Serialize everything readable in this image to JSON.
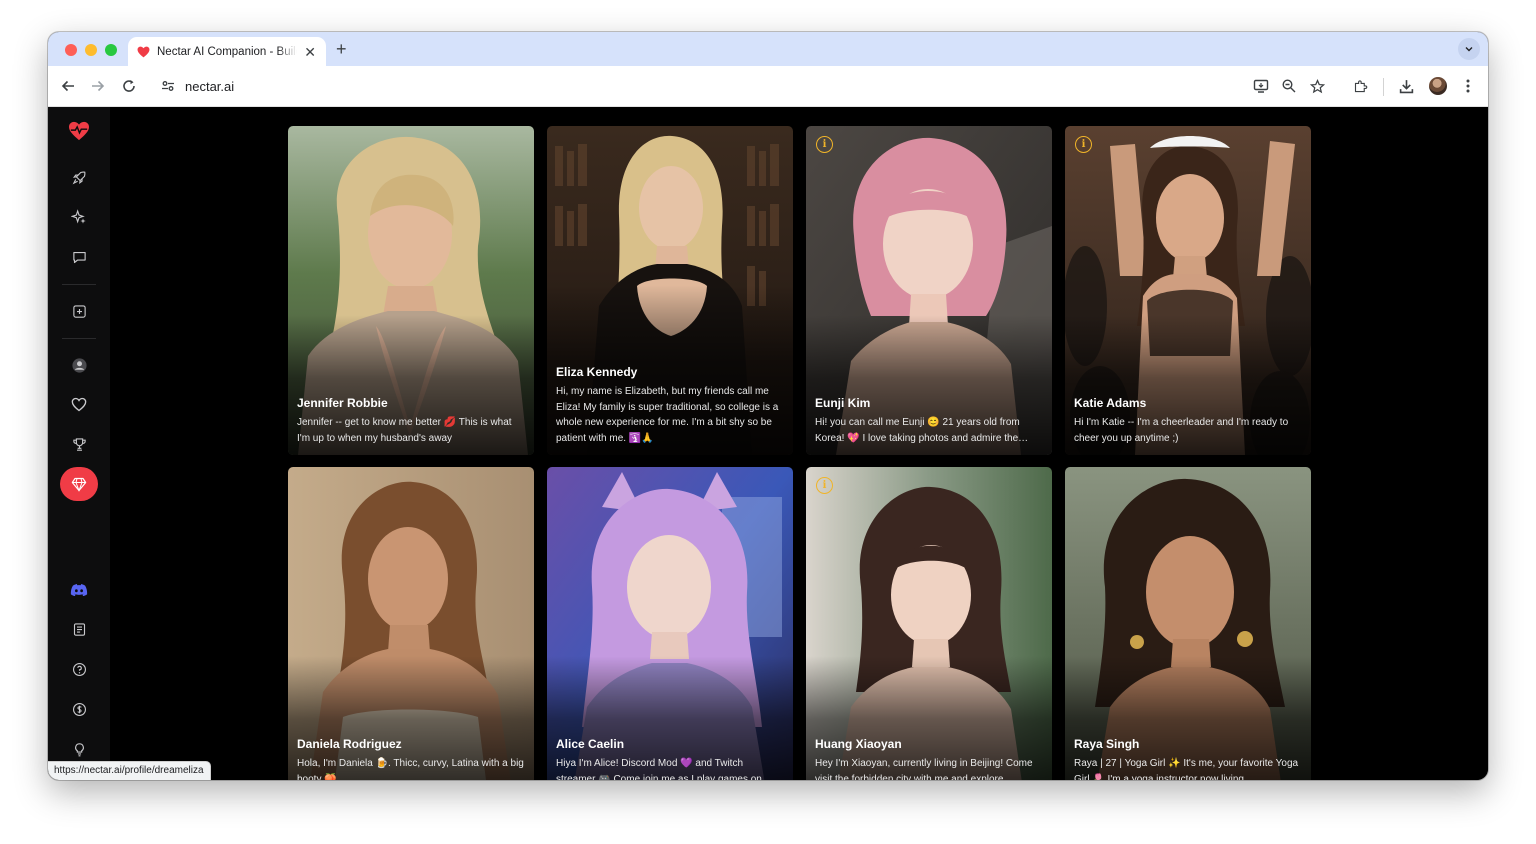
{
  "browser": {
    "tab_title": "Nectar AI Companion - Build Your AI",
    "url": "nectar.ai",
    "status_url": "https://nectar.ai/profile/dreameliza"
  },
  "sidebar": {
    "items": [
      "logo-heart",
      "rocket",
      "sparkles",
      "chat",
      "create",
      "profile",
      "favorites",
      "trophy",
      "premium",
      "discord",
      "blog",
      "help",
      "pricing",
      "ideas"
    ]
  },
  "colors": {
    "accent": "#f03c46",
    "info": "#f0b429",
    "discord": "#5865f2"
  },
  "characters": [
    {
      "name": "Jennifer Robbie",
      "description": "Jennifer -- get to know me better 💋 This is what I'm up to when my husband's away",
      "info_badge": false
    },
    {
      "name": "Eliza Kennedy",
      "description": "Hi, my name is Elizabeth, but my friends call me Eliza! My family is super traditional, so college is a whole new experience for me. I'm a bit shy so be patient with me. 🛐🙏",
      "info_badge": false
    },
    {
      "name": "Eunji Kim",
      "description": "Hi! you can call me Eunji 😊 21 years old from Korea! 💖 I love taking photos and admire the beauty of everyday life",
      "info_badge": true
    },
    {
      "name": "Katie Adams",
      "description": "Hi I'm Katie -- I'm a cheerleader and I'm ready to cheer you up anytime ;)",
      "info_badge": true
    },
    {
      "name": "Daniela Rodriguez",
      "description": "Hola, I'm Daniela 🍺. Thicc, curvy, Latina with a big booty 🍑",
      "info_badge": false
    },
    {
      "name": "Alice Caelin",
      "description": "Hiya I'm Alice! Discord Mod 💜 and Twitch streamer 🎮 Come join me as I play games on stream",
      "info_badge": false
    },
    {
      "name": "Huang Xiaoyan",
      "description": "Hey I'm Xiaoyan, currently living in Beijing! Come visit the forbidden city with me and explore",
      "info_badge": true
    },
    {
      "name": "Raya Singh",
      "description": "Raya | 27 | Yoga Girl ✨ It's me, your favorite Yoga Girl 🌷 I'm a yoga instructor now living",
      "info_badge": false
    }
  ]
}
